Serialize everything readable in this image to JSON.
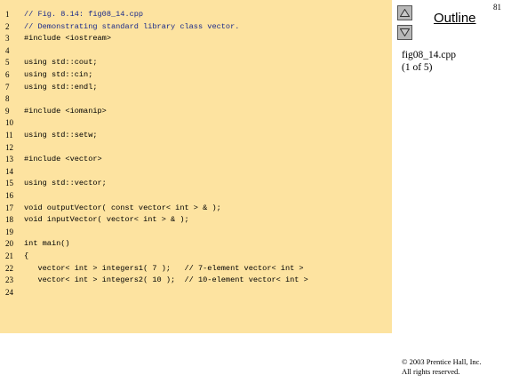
{
  "slide_number": "81",
  "outline_label": "Outline",
  "file_name": "fig08_14.cpp",
  "page_info": "(1 of 5)",
  "copyright": [
    "© 2003 Prentice Hall, Inc.",
    "All rights reserved."
  ],
  "code_lines": [
    {
      "n": "1",
      "text": "// Fig. 8.14: fig08_14.cpp",
      "style": "comment"
    },
    {
      "n": "2",
      "text": "// Demonstrating standard library class vector.",
      "style": "comment"
    },
    {
      "n": "3",
      "text": "#include <iostream>",
      "style": "kw"
    },
    {
      "n": "4",
      "text": "",
      "style": "kw"
    },
    {
      "n": "5",
      "text": "using std::cout;",
      "style": "kw"
    },
    {
      "n": "6",
      "text": "using std::cin;",
      "style": "kw"
    },
    {
      "n": "7",
      "text": "using std::endl;",
      "style": "kw"
    },
    {
      "n": "8",
      "text": "",
      "style": "kw"
    },
    {
      "n": "9",
      "text": "#include <iomanip>",
      "style": "kw"
    },
    {
      "n": "10",
      "text": "",
      "style": "kw"
    },
    {
      "n": "11",
      "text": "using std::setw;",
      "style": "kw"
    },
    {
      "n": "12",
      "text": "",
      "style": "kw"
    },
    {
      "n": "13",
      "text": "#include <vector>",
      "style": "kw"
    },
    {
      "n": "14",
      "text": "",
      "style": "kw"
    },
    {
      "n": "15",
      "text": "using std::vector;",
      "style": "kw"
    },
    {
      "n": "16",
      "text": "",
      "style": "kw"
    },
    {
      "n": "17",
      "text": "void outputVector( const vector< int > & );",
      "style": "kw"
    },
    {
      "n": "18",
      "text": "void inputVector( vector< int > & );",
      "style": "kw"
    },
    {
      "n": "19",
      "text": "",
      "style": "kw"
    },
    {
      "n": "20",
      "text": "int main()",
      "style": "kw"
    },
    {
      "n": "21",
      "text": "{",
      "style": "kw"
    },
    {
      "n": "22",
      "text": "   vector< int > integers1( 7 );   // 7-element vector< int >",
      "style": "kw"
    },
    {
      "n": "23",
      "text": "   vector< int > integers2( 10 );  // 10-element vector< int >",
      "style": "kw"
    },
    {
      "n": "24",
      "text": "",
      "style": "kw"
    }
  ]
}
